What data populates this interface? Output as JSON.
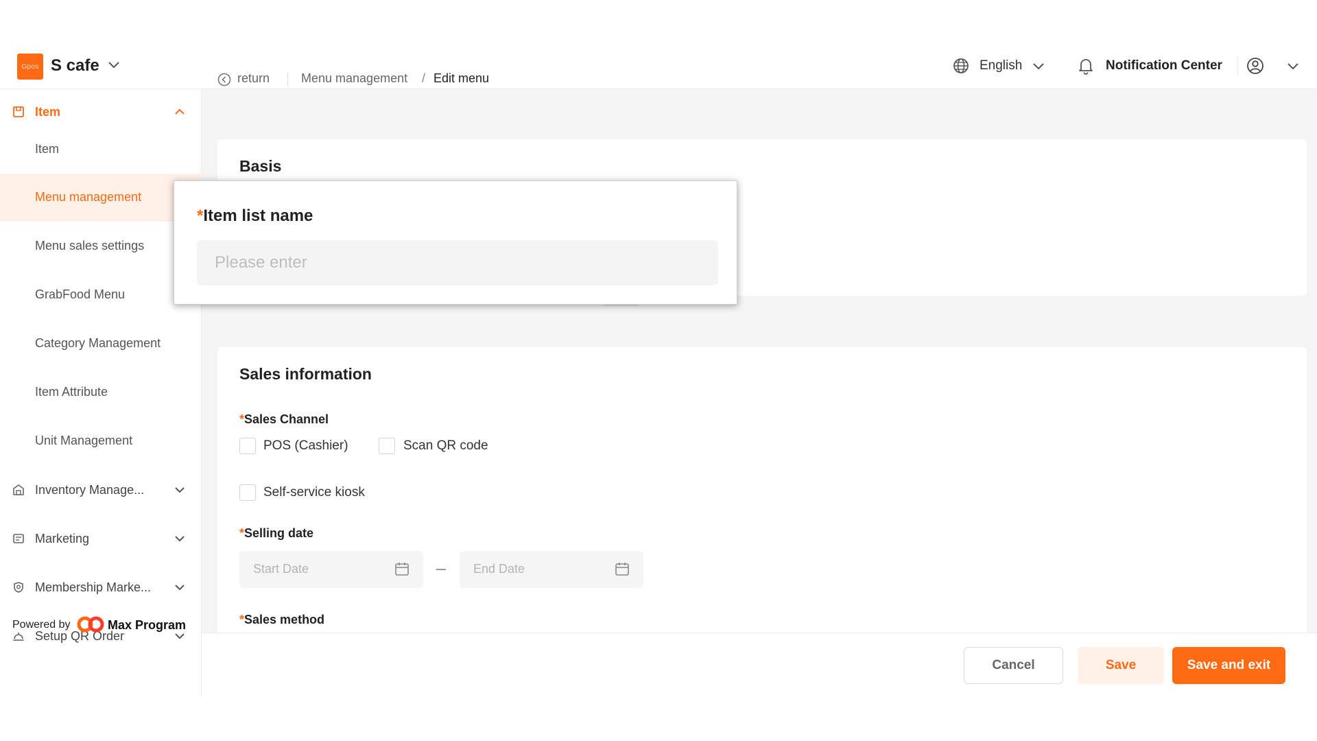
{
  "header": {
    "logo_text": "Gpos",
    "store_name": "S cafe",
    "language": "English",
    "notification_label": "Notification Center"
  },
  "sidebar": {
    "groups": [
      {
        "label": "Item",
        "icon": "item-icon",
        "open": true
      },
      {
        "label": "Inventory Manage...",
        "icon": "inventory-icon",
        "open": false
      },
      {
        "label": "Marketing",
        "icon": "marketing-icon",
        "open": false
      },
      {
        "label": "Membership Marke...",
        "icon": "membership-icon",
        "open": false
      },
      {
        "label": "Setup QR Order",
        "icon": "qr-order-icon",
        "open": false
      }
    ],
    "item_subitems": [
      {
        "label": "Item"
      },
      {
        "label": "Menu management",
        "active": true
      },
      {
        "label": "Menu sales settings"
      },
      {
        "label": "GrabFood Menu"
      },
      {
        "label": "Category Management"
      },
      {
        "label": "Item Attribute"
      },
      {
        "label": "Unit Management"
      }
    ],
    "powered_by": "Powered by",
    "brand_name": "Max Program"
  },
  "breadcrumb": {
    "return_label": "return",
    "items": [
      "Menu management",
      "Edit menu"
    ],
    "separator": "/"
  },
  "basis": {
    "title": "Basis",
    "item_list_name": {
      "required_mark": "*",
      "label": "Item list name",
      "placeholder": "Please enter",
      "value": ""
    }
  },
  "sales_info": {
    "title": "Sales information",
    "sales_channel": {
      "required_mark": "*",
      "label": "Sales Channel",
      "options": [
        {
          "label": "POS (Cashier)",
          "checked": false
        },
        {
          "label": "Scan QR code",
          "checked": false
        },
        {
          "label": "Self-service kiosk",
          "checked": false
        }
      ]
    },
    "selling_date": {
      "required_mark": "*",
      "label": "Selling date",
      "start_placeholder": "Start Date",
      "end_placeholder": "End Date"
    },
    "sales_method": {
      "required_mark": "*",
      "label": "Sales method"
    }
  },
  "footer": {
    "cancel_label": "Cancel",
    "save_label": "Save",
    "save_exit_label": "Save and exit"
  },
  "colors": {
    "accent": "#ff6a13",
    "accent_light": "#fff1e8",
    "background": "#f5f5f5"
  }
}
